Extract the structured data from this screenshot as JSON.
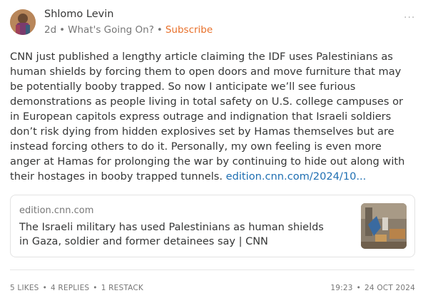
{
  "post": {
    "author": "Shlomo Levin",
    "age": "2d",
    "publication": "What's Going On?",
    "subscribe_label": "Subscribe",
    "more_icon": "ellipsis-icon",
    "more_glyph": "···",
    "avatar_icon": "user-avatar",
    "body": "CNN just published a lengthy article claiming the IDF uses Palestinians as human shields by forcing them to open doors and move furniture that may be potentially booby trapped. So now I anticipate we’ll see furious demonstrations as people living in total safety on U.S. college campuses or in European capitols express outrage and indignation that Israeli soldiers don’t risk dying from hidden explosives set by Hamas themselves but are instead forcing others to do it. Personally, my own feeling is even more anger at Hamas for prolonging the war by continuing to hide out along with their hostages in booby trapped tunnels.",
    "body_link": "edition.cnn.com/2024/10..."
  },
  "link_card": {
    "domain": "edition.cnn.com",
    "title": "The Israeli military has used Palestinians as human shields in Gaza, soldier and former detainees say | CNN",
    "thumbnail_icon": "article-thumbnail"
  },
  "footer": {
    "likes": "5 LIKES",
    "replies": "4 REPLIES",
    "restacks": "1 RESTACK",
    "time": "19:23",
    "date": "24 OCT 2024",
    "separator": "•"
  },
  "colors": {
    "accent": "#e8702a",
    "link": "#1f6fb2",
    "text": "#363737",
    "muted": "#777777",
    "border": "#e3e3e3"
  }
}
